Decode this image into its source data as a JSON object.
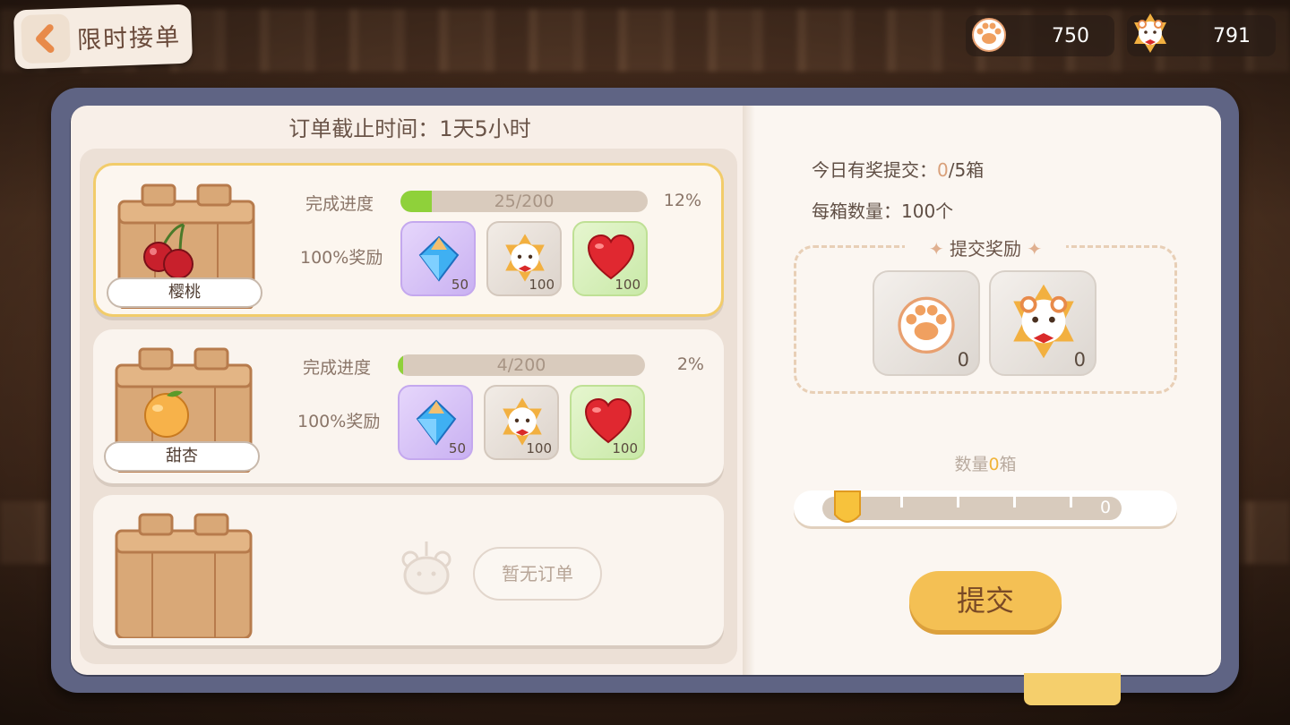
{
  "header": {
    "back_title": "限时接单"
  },
  "currency": [
    {
      "icon": "paw-icon",
      "value": "750"
    },
    {
      "icon": "bear-medal-icon",
      "value": "791"
    }
  ],
  "deadline": "订单截止时间：1天5小时",
  "orders": [
    {
      "fruit": "樱桃",
      "fruit_icon": "cherry-icon",
      "progress_label": "完成进度",
      "progress_text": "25/200",
      "progress_fraction": 0.125,
      "percent": "12%",
      "reward_label": "100%奖励",
      "rewards": [
        {
          "icon": "diamond-icon",
          "qty": "50"
        },
        {
          "icon": "bear-medal-icon",
          "qty": "100"
        },
        {
          "icon": "heart-icon",
          "qty": "100"
        }
      ]
    },
    {
      "fruit": "甜杏",
      "fruit_icon": "apricot-icon",
      "progress_label": "完成进度",
      "progress_text": "4/200",
      "progress_fraction": 0.02,
      "percent": "2%",
      "reward_label": "100%奖励",
      "rewards": [
        {
          "icon": "diamond-icon",
          "qty": "50"
        },
        {
          "icon": "bear-medal-icon",
          "qty": "100"
        },
        {
          "icon": "heart-icon",
          "qty": "100"
        }
      ]
    }
  ],
  "empty_slot": {
    "text": "暂无订单"
  },
  "submit_panel": {
    "daily_label": "今日有奖提交：",
    "daily_done": "0",
    "daily_total": "/5箱",
    "per_box": "每箱数量：100个",
    "reward_title": "提交奖励",
    "rewards": [
      {
        "icon": "paw-icon",
        "qty": "0"
      },
      {
        "icon": "bear-medal-icon",
        "qty": "0"
      }
    ],
    "qty_prefix": "数量",
    "qty_value": "0",
    "qty_suffix": "箱",
    "slider_value": "0",
    "submit_label": "提交"
  },
  "colors": {
    "accent": "#f4c054",
    "progress": "#8fd13a",
    "book": "#5f6484"
  }
}
